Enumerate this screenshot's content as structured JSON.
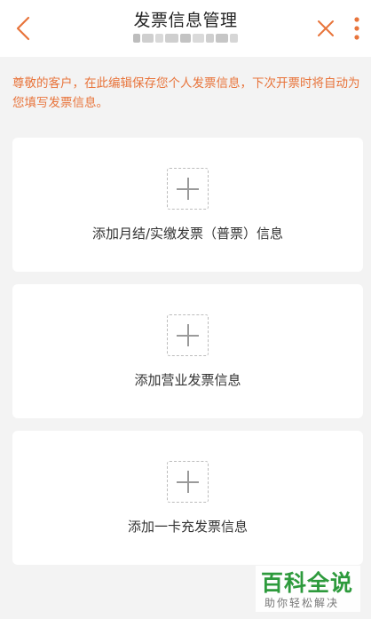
{
  "header": {
    "title": "发票信息管理",
    "back_icon": "chevron-left-icon",
    "close_icon": "close-icon",
    "more_icon": "more-vertical-icon",
    "accent_color": "#e8743b"
  },
  "notice": {
    "text": "尊敬的客户，在此编辑保存您个人发票信息，下次开票时将自动为您填写发票信息。"
  },
  "cards": [
    {
      "label": "添加月结/实缴发票（普票）信息"
    },
    {
      "label": "添加营业发票信息"
    },
    {
      "label": "添加一卡充发票信息"
    }
  ],
  "watermark": {
    "title": "百科全说",
    "subtitle": "助你轻松解决"
  }
}
